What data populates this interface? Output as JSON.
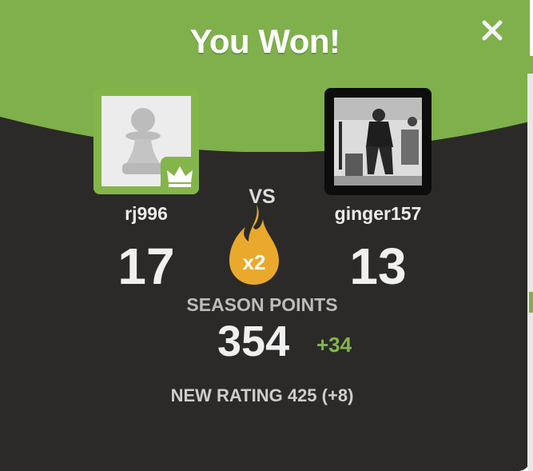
{
  "modal": {
    "title": "You Won!",
    "close_icon": "close-icon",
    "colors": {
      "header": "#7fb04c",
      "background": "#2b2a28",
      "accent": "#81b64c",
      "flame": "#e9a92c"
    }
  },
  "players": {
    "left": {
      "name": "rj996",
      "score": "17",
      "avatar": "pawn-avatar",
      "badge": "crown-icon"
    },
    "right": {
      "name": "ginger157",
      "score": "13",
      "avatar": "photo-avatar"
    }
  },
  "versus": {
    "label": "VS",
    "multiplier": "x2",
    "icon": "flame-icon"
  },
  "season": {
    "label": "SEASON POINTS",
    "points": "354",
    "delta": "+34"
  },
  "rating": {
    "text": "NEW RATING 425 (+8)"
  }
}
